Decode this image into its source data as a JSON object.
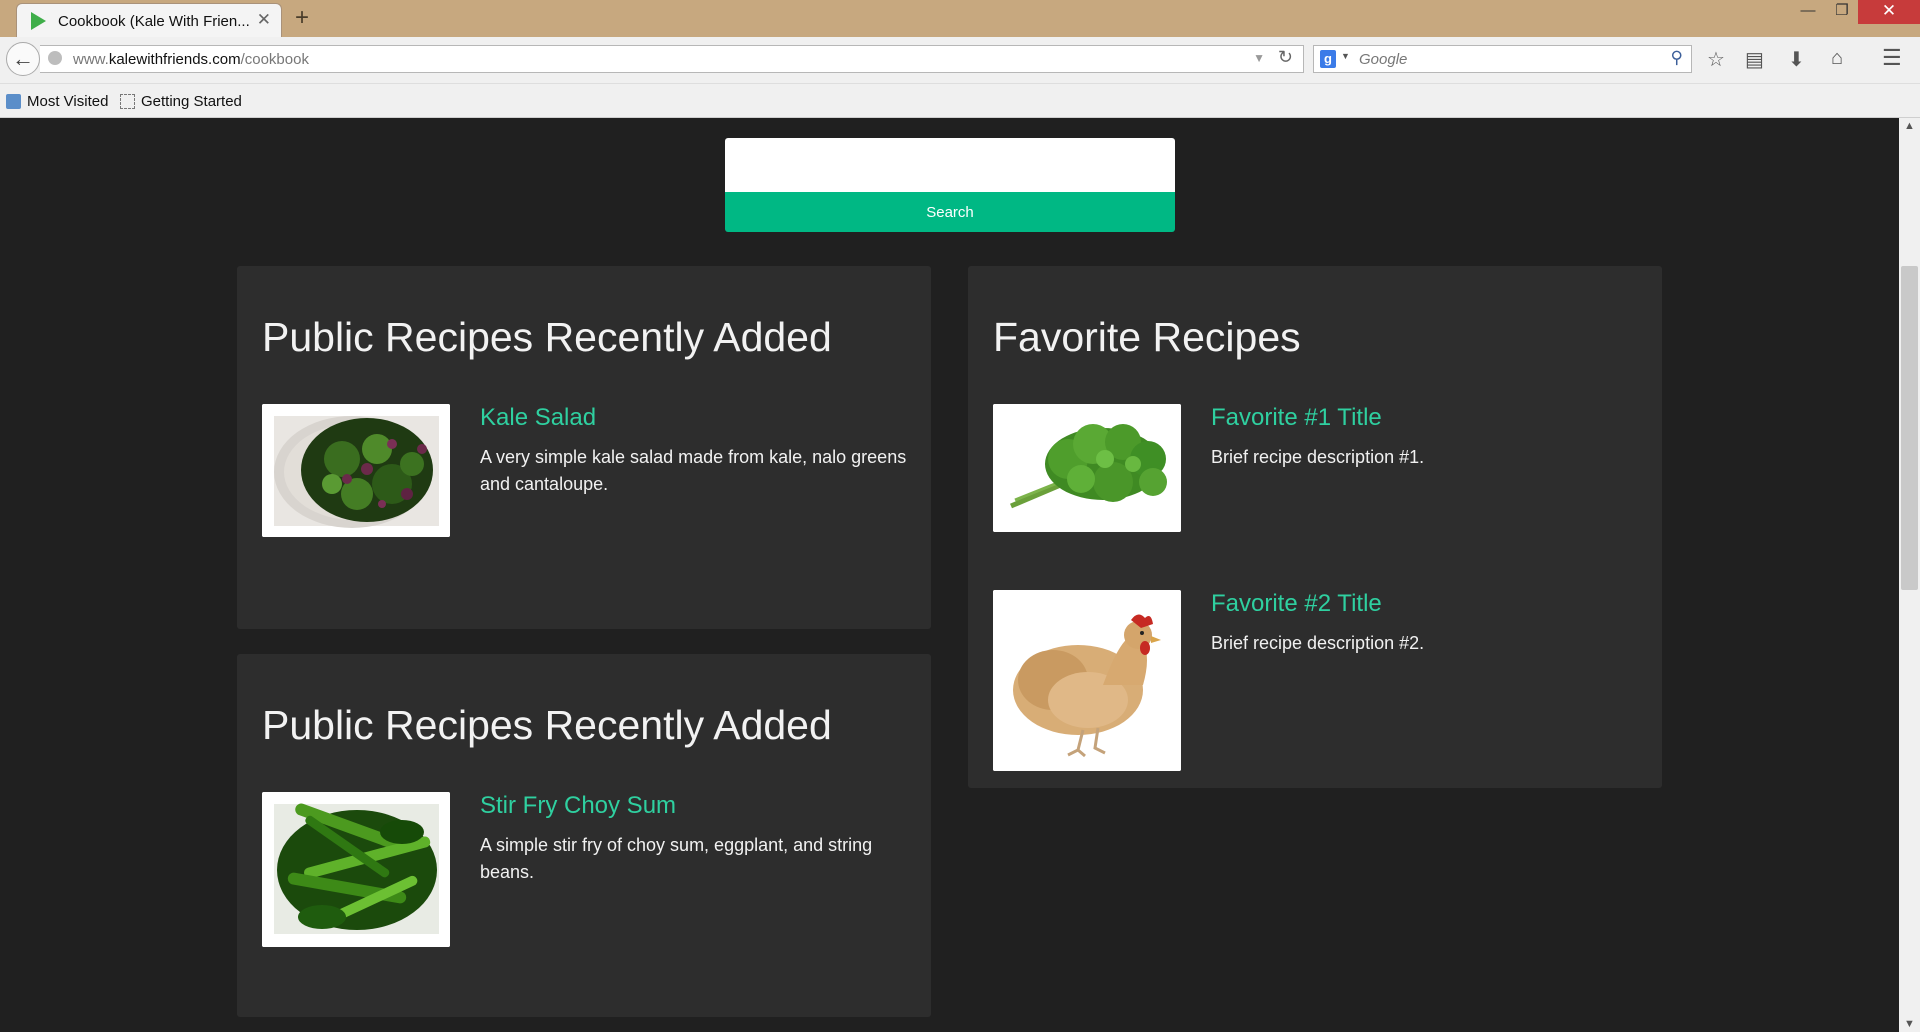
{
  "browser": {
    "tab_title": "Cookbook (Kale With Frien...",
    "url_prefix": "www.",
    "url_host": "kalewithfriends.com",
    "url_path": "/cookbook",
    "search_placeholder": "Google",
    "bookmarks": [
      "Most Visited",
      "Getting Started"
    ]
  },
  "page": {
    "search_button": "Search",
    "search_value": ""
  },
  "cards": [
    {
      "title": "Public Recipes Recently Added",
      "recipes": [
        {
          "title": "Kale Salad",
          "description": "A very simple kale salad made from kale, nalo greens and cantaloupe.",
          "image": "kale-salad"
        }
      ]
    },
    {
      "title": "Public Recipes Recently Added",
      "recipes": [
        {
          "title": "Stir Fry Choy Sum",
          "description": "A simple stir fry of choy sum, eggplant, and string beans.",
          "image": "stir-fry-choy-sum"
        }
      ]
    },
    {
      "title": "Favorite Recipes",
      "recipes": [
        {
          "title": "Favorite #1 Title",
          "description": "Brief recipe description #1.",
          "image": "kale"
        },
        {
          "title": "Favorite #2 Title",
          "description": "Brief recipe description #2.",
          "image": "chicken"
        }
      ]
    }
  ],
  "colors": {
    "accent": "#00b884",
    "link": "#2fd0a0",
    "background": "#202020",
    "card": "#2d2d2d"
  }
}
